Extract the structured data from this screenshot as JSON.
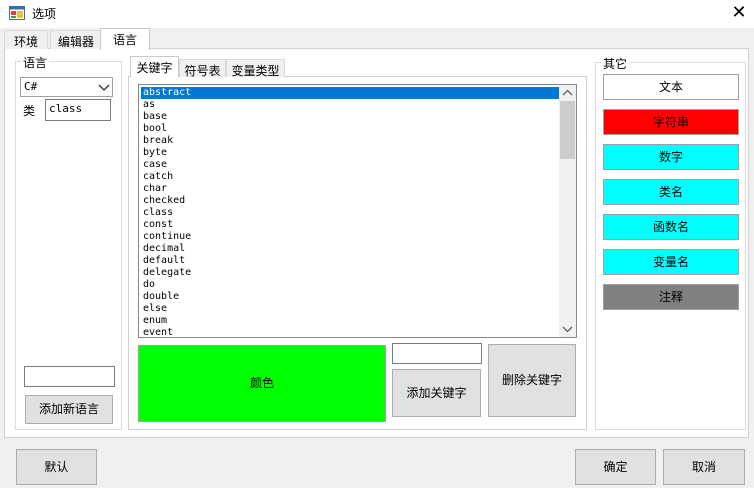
{
  "window": {
    "title": "选项",
    "close_glyph": "✕"
  },
  "tabs": [
    {
      "label": "环境",
      "active": false
    },
    {
      "label": "编辑器",
      "active": false
    },
    {
      "label": "语言",
      "active": true
    }
  ],
  "language_group": {
    "label": "语言",
    "selected_language": "C#",
    "class_label": "类",
    "class_value": "class",
    "new_language_value": "",
    "add_language_button": "添加新语言"
  },
  "inner_tabs": [
    {
      "label": "关键字",
      "active": true
    },
    {
      "label": "符号表",
      "active": false
    },
    {
      "label": "变量类型",
      "active": false
    }
  ],
  "keywords": {
    "items": [
      "abstract",
      "as",
      "base",
      "bool",
      "break",
      "byte",
      "case",
      "catch",
      "char",
      "checked",
      "class",
      "const",
      "continue",
      "decimal",
      "default",
      "delegate",
      "do",
      "double",
      "else",
      "enum",
      "event"
    ],
    "selected_index": 0,
    "color_button_label": "颜色",
    "color_button_color": "#00ff00",
    "new_keyword_value": "",
    "add_keyword_button": "添加关键字",
    "delete_keyword_button": "删除关键字"
  },
  "other_group": {
    "label": "其它",
    "color_buttons": [
      {
        "label": "文本",
        "color": "#ffffff"
      },
      {
        "label": "字符串",
        "color": "#ff0000"
      },
      {
        "label": "数字",
        "color": "#00ffff"
      },
      {
        "label": "类名",
        "color": "#00ffff"
      },
      {
        "label": "函数名",
        "color": "#00ffff"
      },
      {
        "label": "变量名",
        "color": "#00ffff"
      },
      {
        "label": "注释",
        "color": "#808080"
      }
    ]
  },
  "footer": {
    "default_button": "默认",
    "ok_button": "确定",
    "cancel_button": "取消"
  }
}
